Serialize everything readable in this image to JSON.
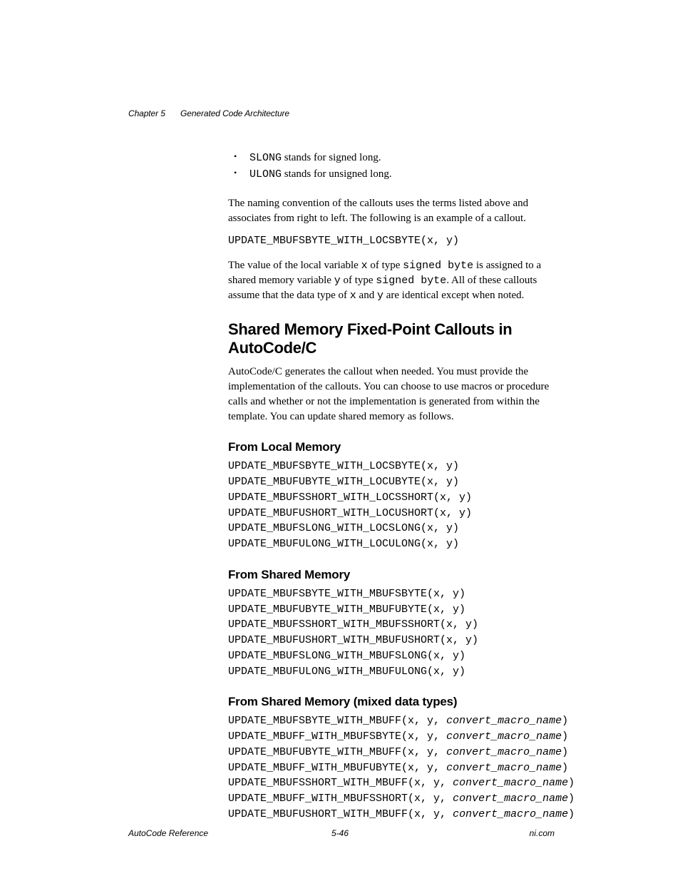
{
  "header": {
    "chapter_no": "Chapter 5",
    "chapter_title": "Generated Code Architecture"
  },
  "bullets": [
    {
      "code": "SLONG",
      "text": " stands for signed long."
    },
    {
      "code": "ULONG",
      "text": " stands for unsigned long."
    }
  ],
  "para1": "The naming convention of the callouts uses the terms listed above and associates from right to left. The following is an example of a callout.",
  "code1": "UPDATE_MBUFSBYTE_WITH_LOCSBYTE(x, y)",
  "para2": {
    "t1": "The value of the local variable ",
    "c1": "x",
    "t2": " of type ",
    "c2": "signed byte",
    "t3": " is assigned to a shared memory variable ",
    "c3": "y",
    "t4": " of type ",
    "c4": "signed byte",
    "t5": ". All of these callouts assume that the data type of ",
    "c5": "x",
    "t6": " and ",
    "c6": "y",
    "t7": " are identical except when noted."
  },
  "section": {
    "title": "Shared Memory Fixed-Point Callouts in AutoCode/C",
    "intro": "AutoCode/C generates the callout when needed. You must provide the implementation of the callouts. You can choose to use macros or procedure calls and whether or not the implementation is generated from within the template. You can update shared memory as follows."
  },
  "sub1": {
    "title": "From Local Memory",
    "code": "UPDATE_MBUFSBYTE_WITH_LOCSBYTE(x, y)\nUPDATE_MBUFUBYTE_WITH_LOCUBYTE(x, y)\nUPDATE_MBUFSSHORT_WITH_LOCSSHORT(x, y)\nUPDATE_MBUFUSHORT_WITH_LOCUSHORT(x, y)\nUPDATE_MBUFSLONG_WITH_LOCSLONG(x, y)\nUPDATE_MBUFULONG_WITH_LOCULONG(x, y)"
  },
  "sub2": {
    "title": "From Shared Memory",
    "code": "UPDATE_MBUFSBYTE_WITH_MBUFSBYTE(x, y)\nUPDATE_MBUFUBYTE_WITH_MBUFUBYTE(x, y)\nUPDATE_MBUFSSHORT_WITH_MBUFSSHORT(x, y)\nUPDATE_MBUFUSHORT_WITH_MBUFUSHORT(x, y)\nUPDATE_MBUFSLONG_WITH_MBUFSLONG(x, y)\nUPDATE_MBUFULONG_WITH_MBUFULONG(x, y)"
  },
  "sub3": {
    "title": "From Shared Memory (mixed data types)",
    "lines": [
      {
        "a": "UPDATE_MBUFSBYTE_WITH_MBUFF(x, y, ",
        "b": "convert_macro_name",
        "c": ")"
      },
      {
        "a": "UPDATE_MBUFF_WITH_MBUFSBYTE(x, y, ",
        "b": "convert_macro_name",
        "c": ")"
      },
      {
        "a": "UPDATE_MBUFUBYTE_WITH_MBUFF(x, y, ",
        "b": "convert_macro_name",
        "c": ")"
      },
      {
        "a": "UPDATE_MBUFF_WITH_MBUFUBYTE(x, y, ",
        "b": "convert_macro_name",
        "c": ")"
      },
      {
        "a": "UPDATE_MBUFSSHORT_WITH_MBUFF(x, y, ",
        "b": "convert_macro_name",
        "c": ")"
      },
      {
        "a": "UPDATE_MBUFF_WITH_MBUFSSHORT(x, y, ",
        "b": "convert_macro_name",
        "c": ")"
      },
      {
        "a": "UPDATE_MBUFUSHORT_WITH_MBUFF(x, y, ",
        "b": "convert_macro_name",
        "c": ")"
      }
    ]
  },
  "footer": {
    "left": "AutoCode Reference",
    "center": "5-46",
    "right": "ni.com"
  }
}
